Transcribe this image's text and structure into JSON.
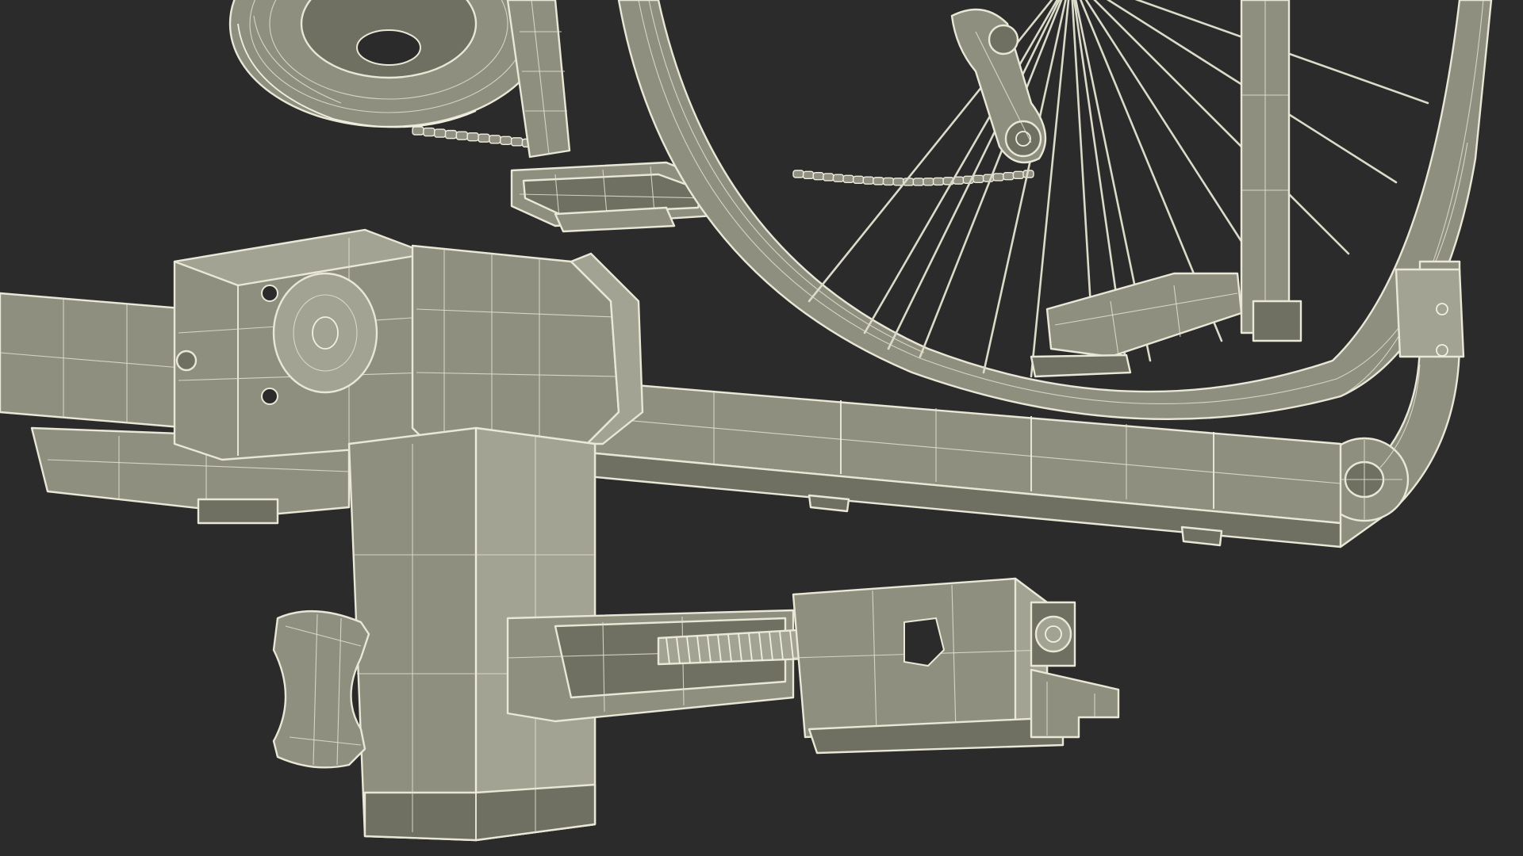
{
  "scene": {
    "background_color": "#2b2b2b",
    "mesh_fill_color": "#8f8f80",
    "wire_color": "#e9e7d6",
    "style": "wireframe-on-shaded"
  },
  "objects": [
    "chainring",
    "bicycle-chain",
    "pedal",
    "crank-arm",
    "rear-wheel-rim",
    "wheel-spokes",
    "rear-derailleur",
    "rack-main-bar",
    "rack-clamp-body",
    "rack-vertical-post",
    "rack-tray-arm",
    "wheel-hoop",
    "wheel-cradle",
    "hitch-bracket",
    "tightening-knob",
    "threaded-rod",
    "tensioner-block"
  ]
}
